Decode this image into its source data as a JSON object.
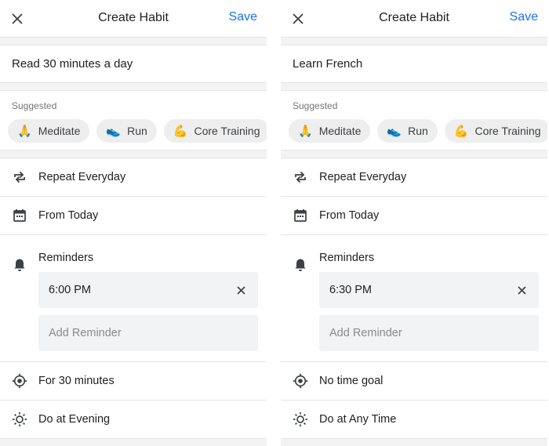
{
  "colors": {
    "accent": "#1a73e8",
    "text": "#202124",
    "muted": "#757575"
  },
  "screens": [
    {
      "header": {
        "title": "Create Habit",
        "save_label": "Save",
        "close_icon": "close-icon"
      },
      "habit_name": "Read 30 minutes a day",
      "suggested": {
        "label": "Suggested",
        "chips": [
          {
            "emoji": "🙏",
            "label": "Meditate"
          },
          {
            "emoji": "👟",
            "label": "Run"
          },
          {
            "emoji": "💪",
            "label": "Core Training"
          }
        ]
      },
      "repeat": "Repeat Everyday",
      "from": "From Today",
      "reminders": {
        "label": "Reminders",
        "time": "6:00 PM",
        "add_placeholder": "Add Reminder"
      },
      "goal": "For 30 minutes",
      "time_of_day": "Do at Evening"
    },
    {
      "header": {
        "title": "Create Habit",
        "save_label": "Save",
        "close_icon": "close-icon"
      },
      "habit_name": "Learn French",
      "suggested": {
        "label": "Suggested",
        "chips": [
          {
            "emoji": "🙏",
            "label": "Meditate"
          },
          {
            "emoji": "👟",
            "label": "Run"
          },
          {
            "emoji": "💪",
            "label": "Core Training"
          }
        ]
      },
      "repeat": "Repeat Everyday",
      "from": "From Today",
      "reminders": {
        "label": "Reminders",
        "time": "6:30 PM",
        "add_placeholder": "Add Reminder"
      },
      "goal": "No time goal",
      "time_of_day": "Do at Any Time"
    }
  ]
}
